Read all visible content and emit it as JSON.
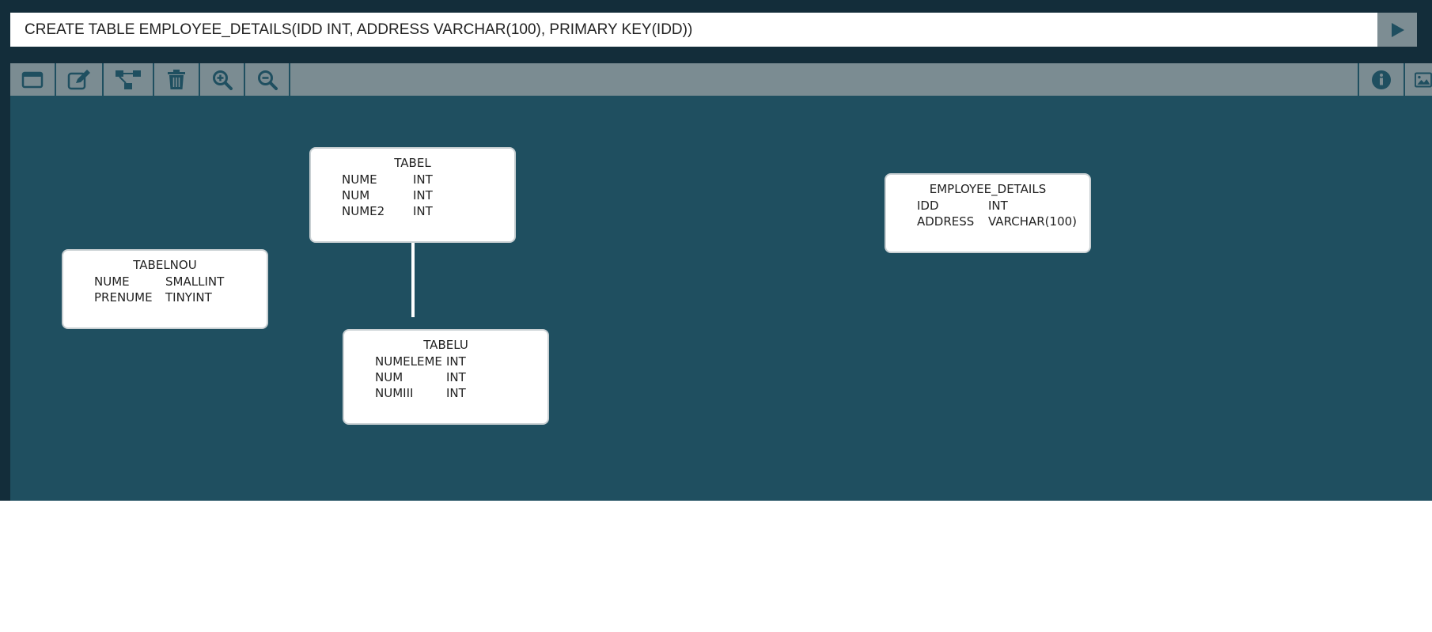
{
  "query": {
    "value": "CREATE TABLE EMPLOYEE_DETAILS(IDD INT, ADDRESS VARCHAR(100), PRIMARY KEY(IDD))",
    "run_icon": "play-icon"
  },
  "toolbar": {
    "left_tools": [
      "window-icon",
      "edit-icon",
      "schema-icon",
      "trash-icon",
      "zoom-in-icon",
      "zoom-out-icon"
    ],
    "right_tools": [
      "info-icon",
      "image-icon"
    ]
  },
  "colors": {
    "app_background": "#132d3a",
    "canvas_background": "#1f4f60",
    "toolbar_background": "#7b8c92",
    "icon_color": "#1f4f60",
    "relation_line": "#ffffff"
  },
  "tables": {
    "tabel": {
      "name": "TABEL",
      "columns": [
        {
          "name": "NUME",
          "type": "INT"
        },
        {
          "name": "NUM",
          "type": "INT"
        },
        {
          "name": "NUME2",
          "type": "INT"
        }
      ]
    },
    "tabelnou": {
      "name": "TABELNOU",
      "columns": [
        {
          "name": "NUME",
          "type": "SMALLINT"
        },
        {
          "name": "PRENUME",
          "type": "TINYINT"
        }
      ]
    },
    "tabelu": {
      "name": "TABELU",
      "columns": [
        {
          "name": "NUMELEME",
          "type": "INT"
        },
        {
          "name": "NUM",
          "type": "INT"
        },
        {
          "name": "NUMIII",
          "type": "INT"
        }
      ]
    },
    "employee_details": {
      "name": "EMPLOYEE_DETAILS",
      "columns": [
        {
          "name": "IDD",
          "type": "INT"
        },
        {
          "name": "ADDRESS",
          "type": "VARCHAR(100)"
        }
      ]
    }
  }
}
